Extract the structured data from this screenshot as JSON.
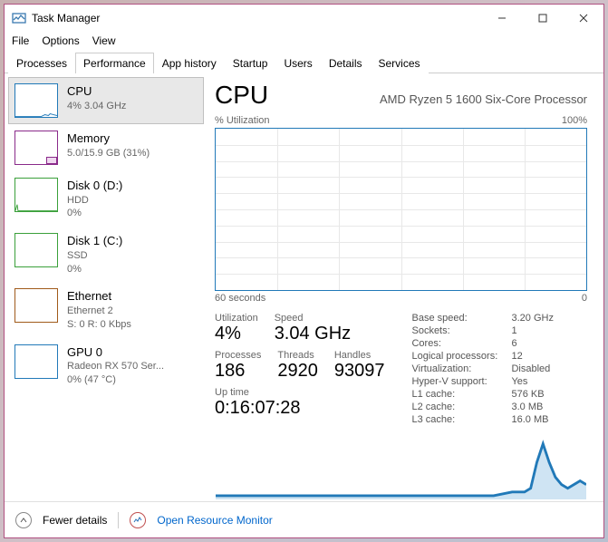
{
  "window": {
    "title": "Task Manager"
  },
  "menu": {
    "file": "File",
    "options": "Options",
    "view": "View"
  },
  "tabs": {
    "processes": "Processes",
    "performance": "Performance",
    "app_history": "App history",
    "startup": "Startup",
    "users": "Users",
    "details": "Details",
    "services": "Services"
  },
  "sidebar": {
    "cpu": {
      "title": "CPU",
      "sub1": "4%  3.04 GHz",
      "color": "#2179b8"
    },
    "memory": {
      "title": "Memory",
      "sub1": "5.0/15.9 GB (31%)",
      "color": "#8a2a8a"
    },
    "disk0": {
      "title": "Disk 0 (D:)",
      "sub1": "HDD",
      "sub2": "0%",
      "color": "#3aa03a"
    },
    "disk1": {
      "title": "Disk 1 (C:)",
      "sub1": "SSD",
      "sub2": "0%",
      "color": "#3aa03a"
    },
    "eth": {
      "title": "Ethernet",
      "sub1": "Ethernet 2",
      "sub2": "S: 0 R: 0 Kbps",
      "color": "#a05a1a"
    },
    "gpu": {
      "title": "GPU 0",
      "sub1": "Radeon RX 570 Ser...",
      "sub2": "0%  (47 °C)",
      "color": "#2179b8"
    }
  },
  "main": {
    "heading": "CPU",
    "subheading": "AMD Ryzen 5 1600 Six-Core Processor",
    "chart_top_left": "% Utilization",
    "chart_top_right": "100%",
    "chart_bottom_left": "60 seconds",
    "chart_bottom_right": "0",
    "stats": {
      "utilization_label": "Utilization",
      "utilization": "4%",
      "speed_label": "Speed",
      "speed": "3.04 GHz",
      "processes_label": "Processes",
      "processes": "186",
      "threads_label": "Threads",
      "threads": "2920",
      "handles_label": "Handles",
      "handles": "93097",
      "uptime_label": "Up time",
      "uptime": "0:16:07:28"
    },
    "kv": {
      "base_speed_l": "Base speed:",
      "base_speed": "3.20 GHz",
      "sockets_l": "Sockets:",
      "sockets": "1",
      "cores_l": "Cores:",
      "cores": "6",
      "logical_l": "Logical processors:",
      "logical": "12",
      "virt_l": "Virtualization:",
      "virt": "Disabled",
      "hyperv_l": "Hyper-V support:",
      "hyperv": "Yes",
      "l1_l": "L1 cache:",
      "l1": "576 KB",
      "l2_l": "L2 cache:",
      "l2": "3.0 MB",
      "l3_l": "L3 cache:",
      "l3": "16.0 MB"
    }
  },
  "footer": {
    "fewer": "Fewer details",
    "orm": "Open Resource Monitor"
  },
  "chart_data": {
    "type": "line",
    "title": "% Utilization",
    "xlabel": "seconds",
    "ylabel": "% Utilization",
    "xlim": [
      60,
      0
    ],
    "ylim": [
      0,
      100
    ],
    "x": [
      60,
      55,
      50,
      45,
      40,
      35,
      30,
      25,
      20,
      15,
      12,
      10,
      9,
      8,
      7,
      6,
      5,
      4,
      3,
      2,
      1,
      0
    ],
    "values": [
      1,
      1,
      1,
      1,
      1,
      1,
      1,
      1,
      1,
      1,
      2,
      2,
      3,
      10,
      15,
      10,
      6,
      4,
      3,
      4,
      5,
      4
    ]
  }
}
